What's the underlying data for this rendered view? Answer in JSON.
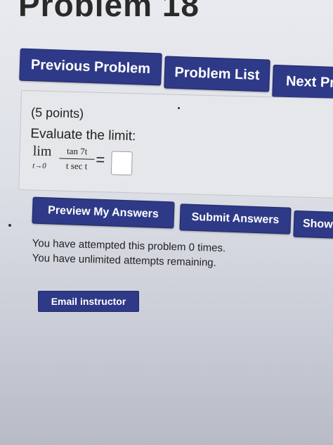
{
  "page": {
    "title": "Problem 18"
  },
  "nav": {
    "previous_label": "Previous Problem",
    "list_label": "Problem List",
    "next_label": "Next Pr"
  },
  "problem": {
    "points": "(5 points)",
    "prompt": "Evaluate the limit:",
    "lim_word": "lim",
    "lim_sub": "t→0",
    "numerator": "tan 7t",
    "denominator": "t sec t",
    "equals": "=",
    "answer_value": ""
  },
  "actions": {
    "preview_label": "Preview My Answers",
    "submit_label": "Submit Answers",
    "show_label": "Show"
  },
  "status": {
    "attempts_line": "You have attempted this problem 0 times.",
    "remaining_line": "You have unlimited attempts remaining."
  },
  "email": {
    "label": "Email instructor"
  },
  "colors": {
    "button_bg": "#2e3a87",
    "panel_bg": "#e6e7ea"
  }
}
